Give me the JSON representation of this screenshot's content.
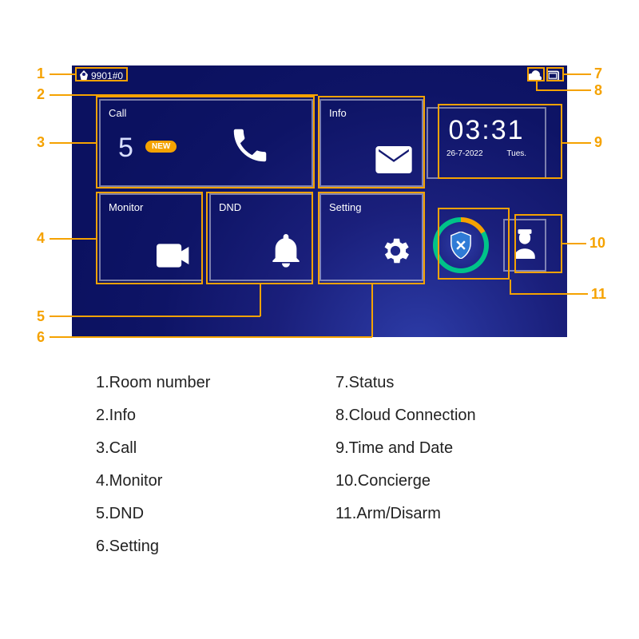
{
  "topbar": {
    "room_number": "9901#0"
  },
  "tiles": {
    "call": {
      "label": "Call",
      "count": "5",
      "badge": "NEW"
    },
    "info": {
      "label": "Info"
    },
    "monitor": {
      "label": "Monitor"
    },
    "dnd": {
      "label": "DND"
    },
    "setting": {
      "label": "Setting"
    }
  },
  "clock": {
    "time": "03:31",
    "date": "26-7-2022",
    "weekday": "Tues."
  },
  "callouts": {
    "n1": "1",
    "n2": "2",
    "n3": "3",
    "n4": "4",
    "n5": "5",
    "n6": "6",
    "n7": "7",
    "n8": "8",
    "n9": "9",
    "n10": "10",
    "n11": "11"
  },
  "legend": {
    "l1": "1.Room number",
    "l2": "2.Info",
    "l3": "3.Call",
    "l4": "4.Monitor",
    "l5": "5.DND",
    "l6": "6.Setting",
    "l7": "7.Status",
    "l8": "8.Cloud Connection",
    "l9": "9.Time and Date",
    "l10": "10.Concierge",
    "l11": "11.Arm/Disarm"
  }
}
